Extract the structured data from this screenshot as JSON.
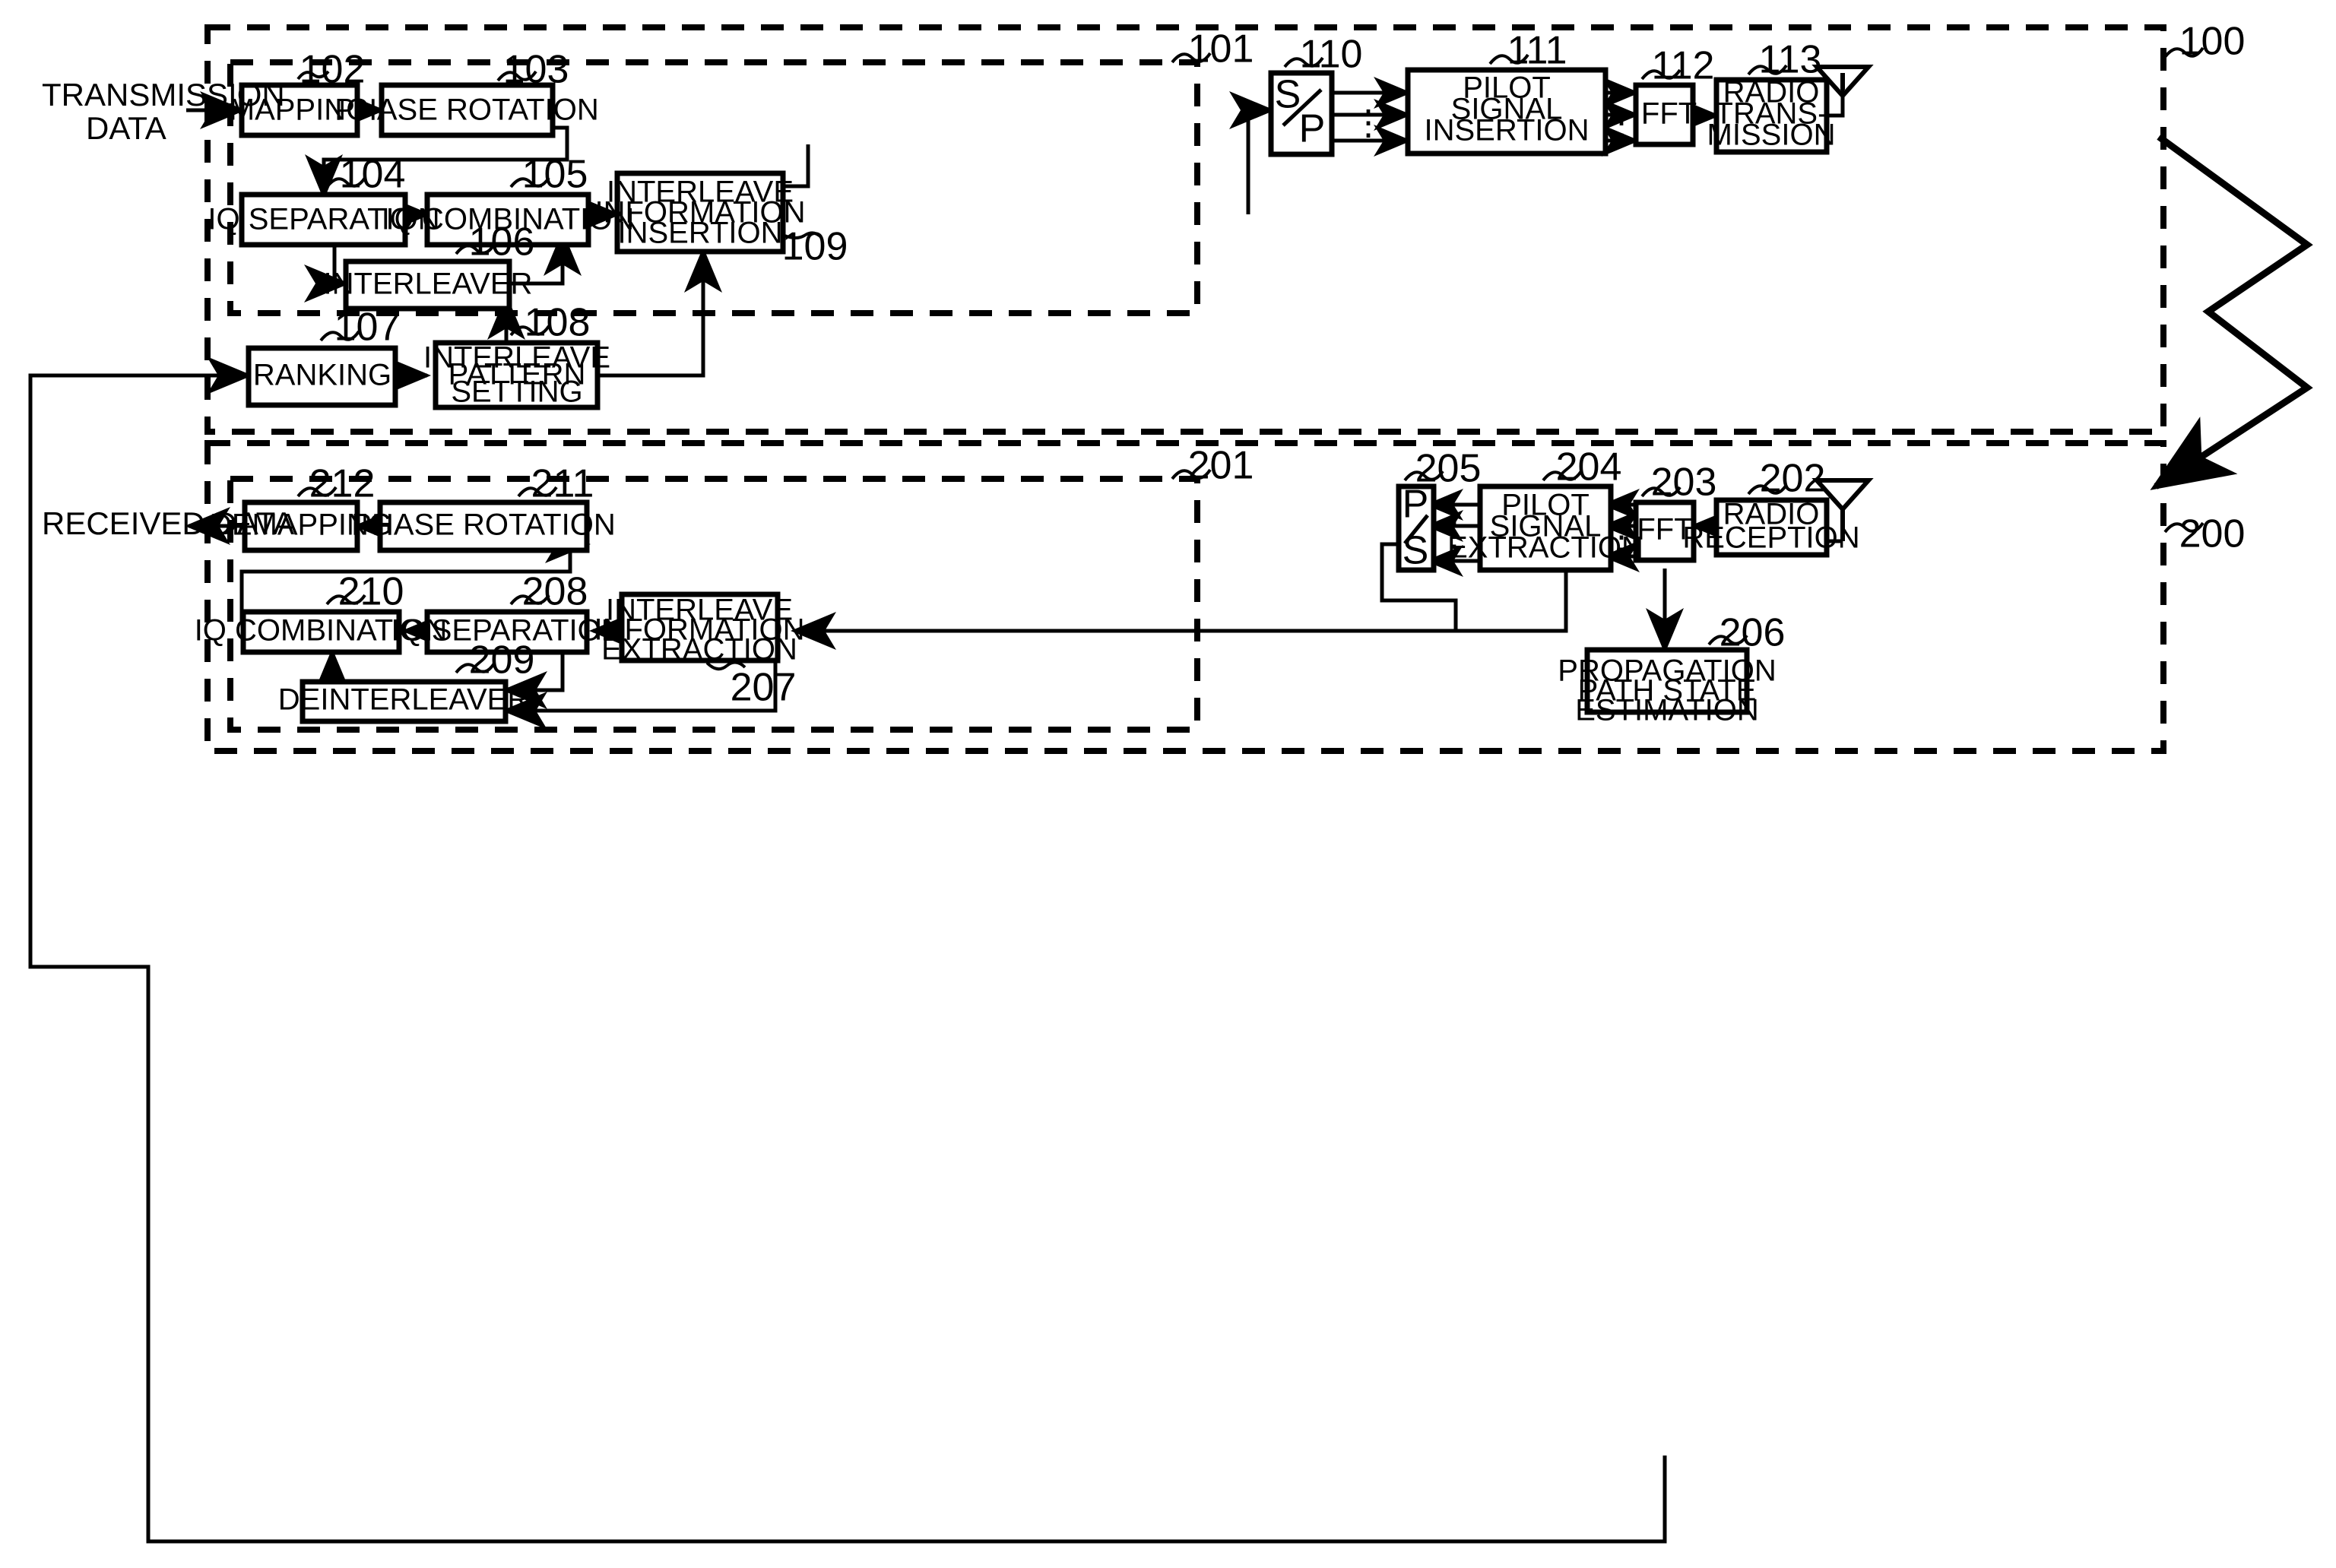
{
  "figure": {
    "type": "patent-block-diagram",
    "title_refs": {
      "transmitter": "100",
      "receiver": "200"
    },
    "io_labels": {
      "input": "TRANSMISSION\nDATA",
      "input_line1": "TRANSMISSION",
      "input_line2": "DATA",
      "output": "RECEIVED DATA"
    }
  },
  "transmitter": {
    "ref": "100",
    "inner_ref": "101",
    "blocks": [
      {
        "ref": "102",
        "label": "MAPPING"
      },
      {
        "ref": "103",
        "label": "PHASE ROTATION"
      },
      {
        "ref": "104",
        "label": "IQ SEPARATION"
      },
      {
        "ref": "105",
        "label": "IQ COMBINATION"
      },
      {
        "ref": "106",
        "label": "INTERLEAVER"
      },
      {
        "ref": "107",
        "label": "RANKING"
      },
      {
        "ref": "108",
        "label": "INTERLEAVE\nPATTERN\nSETTING",
        "lines": [
          "INTERLEAVE",
          "PATTERN",
          "SETTING"
        ]
      },
      {
        "ref": "109",
        "label": "INTERLEAVE\nINFORMATION\nINSERTION",
        "lines": [
          "INTERLEAVE",
          "INFORMATION",
          "INSERTION"
        ]
      },
      {
        "ref": "110",
        "label": "S / P",
        "lines": [
          "S",
          "/",
          "P"
        ]
      },
      {
        "ref": "111",
        "label": "PILOT\nSIGNAL\nINSERTION",
        "lines": [
          "PILOT",
          "SIGNAL",
          "INSERTION"
        ]
      },
      {
        "ref": "112",
        "label": "IFFT"
      },
      {
        "ref": "113",
        "label": "RADIO\nTRANS-\nMISSION",
        "lines": [
          "RADIO",
          "TRANS-",
          "MISSION"
        ]
      }
    ]
  },
  "receiver": {
    "ref": "200",
    "inner_ref": "201",
    "blocks": [
      {
        "ref": "202",
        "label": "RADIO\nRECEPTION",
        "lines": [
          "RADIO",
          "RECEPTION"
        ]
      },
      {
        "ref": "203",
        "label": "FFT"
      },
      {
        "ref": "204",
        "label": "PILOT\nSIGNAL\nEXTRACTION",
        "lines": [
          "PILOT",
          "SIGNAL",
          "EXTRACTION"
        ]
      },
      {
        "ref": "205",
        "label": "P / S",
        "lines": [
          "P",
          "/",
          "S"
        ]
      },
      {
        "ref": "206",
        "label": "PROPAGATION\nPATH STATE\nESTIMATION",
        "lines": [
          "PROPAGATION",
          "PATH STATE",
          "ESTIMATION"
        ]
      },
      {
        "ref": "207",
        "label": "INTERLEAVE\nINFORMATION\nEXTRACTION",
        "lines": [
          "INTERLEAVE",
          "INFORMATION",
          "EXTRACTION"
        ]
      },
      {
        "ref": "208",
        "label": "IQ SEPARATION"
      },
      {
        "ref": "209",
        "label": "DEINTERLEAVER"
      },
      {
        "ref": "210",
        "label": "IQ COMBINATION"
      },
      {
        "ref": "211",
        "label": "PHASE ROTATION"
      },
      {
        "ref": "212",
        "label": "DEMAPPING"
      }
    ]
  },
  "icons": {
    "tx_antenna": "antenna-icon",
    "rx_antenna": "antenna-icon",
    "channel": "lightning-channel-arrow",
    "vertical_ellipsis": "⋮"
  },
  "colors": {
    "ink": "#000000",
    "paper": "#ffffff"
  }
}
